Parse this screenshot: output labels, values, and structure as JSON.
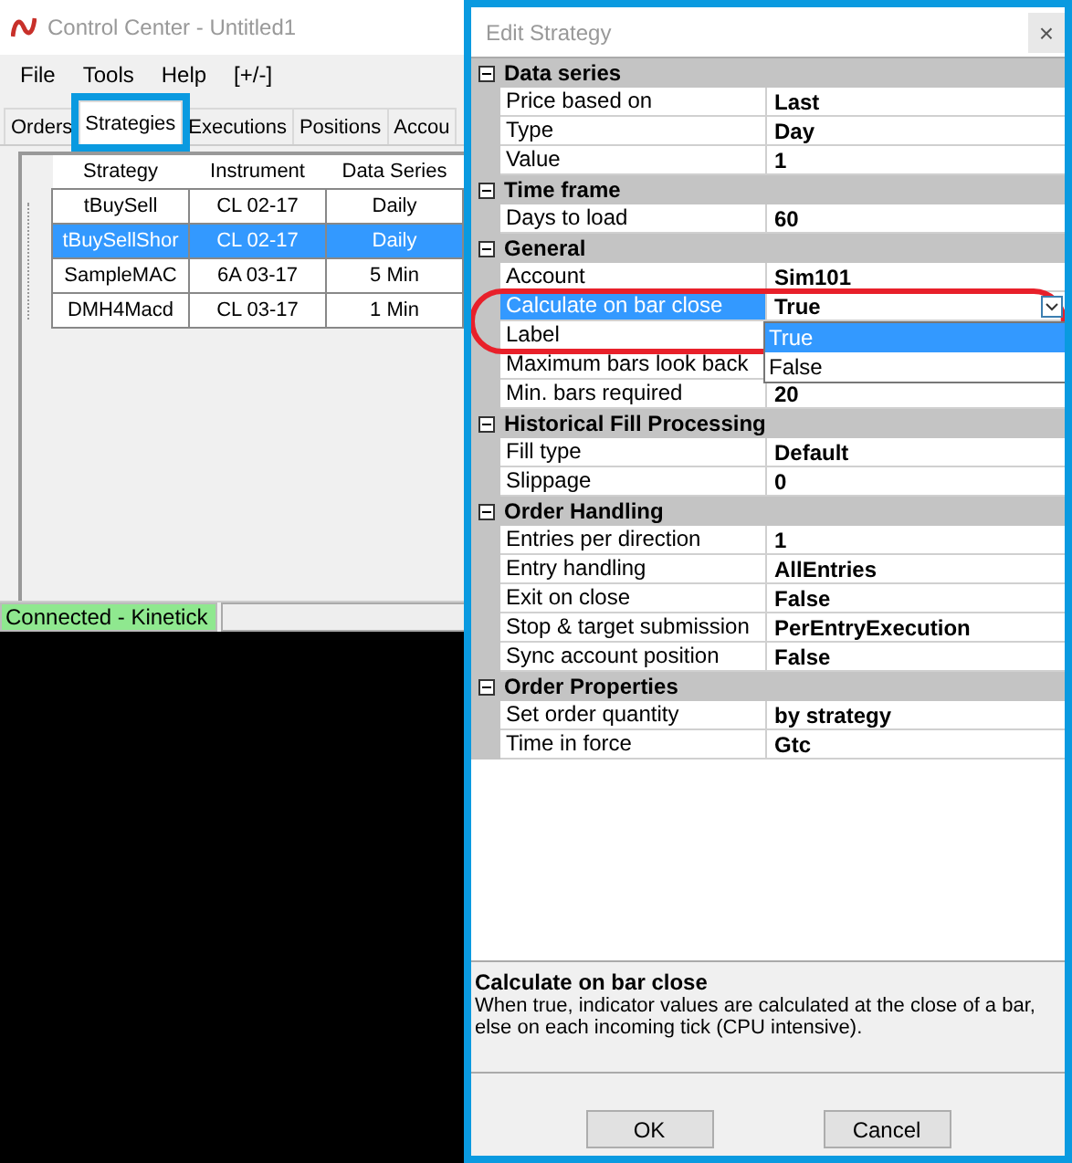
{
  "app_window": {
    "title": "Control Center - Untitled1",
    "menu": [
      "File",
      "Tools",
      "Help",
      "[+/-]"
    ],
    "tabs": [
      {
        "label": "Orders",
        "selected": false,
        "highlighted": false
      },
      {
        "label": "Strategies",
        "selected": true,
        "highlighted": true
      },
      {
        "label": "Executions",
        "selected": false,
        "highlighted": false
      },
      {
        "label": "Positions",
        "selected": false,
        "highlighted": false
      },
      {
        "label": "Accou",
        "selected": false,
        "highlighted": false
      }
    ],
    "strategies_table": {
      "columns": [
        "Strategy",
        "Instrument",
        "Data Series"
      ],
      "rows": [
        {
          "cells": [
            "tBuySell",
            "CL 02-17",
            "Daily"
          ],
          "selected": false
        },
        {
          "cells": [
            "tBuySellShor",
            "CL 02-17",
            "Daily"
          ],
          "selected": true
        },
        {
          "cells": [
            "SampleMAC",
            "6A 03-17",
            "5 Min"
          ],
          "selected": false
        },
        {
          "cells": [
            "DMH4Macd",
            "CL 03-17",
            "1 Min"
          ],
          "selected": false
        }
      ]
    },
    "status_bar": {
      "connection": "Connected - Kinetick",
      "connected": true
    }
  },
  "dialog": {
    "title": "Edit Strategy",
    "close_label": "×",
    "highlighted": true,
    "categories": [
      {
        "name": "Data series",
        "expanded": true,
        "properties": [
          {
            "name": "Price based on",
            "value": "Last",
            "selected": false,
            "kind": "text"
          },
          {
            "name": "Type",
            "value": "Day",
            "selected": false,
            "kind": "text"
          },
          {
            "name": "Value",
            "value": "1",
            "selected": false,
            "kind": "text"
          }
        ]
      },
      {
        "name": "Time frame",
        "expanded": true,
        "properties": [
          {
            "name": "Days to load",
            "value": "60",
            "selected": false,
            "kind": "text"
          }
        ]
      },
      {
        "name": "General",
        "expanded": true,
        "properties": [
          {
            "name": "Account",
            "value": "Sim101",
            "selected": false,
            "kind": "text"
          },
          {
            "name": "Calculate on bar close",
            "value": "True",
            "selected": true,
            "kind": "dropdown",
            "circled": true
          },
          {
            "name": "Label",
            "selected": false,
            "kind": "text"
          },
          {
            "name": "Maximum bars look back",
            "selected": false,
            "kind": "text"
          },
          {
            "name": "Min. bars required",
            "value": "20",
            "selected": false,
            "kind": "text"
          }
        ]
      },
      {
        "name": "Historical Fill Processing",
        "expanded": true,
        "properties": [
          {
            "name": "Fill type",
            "value": "Default",
            "selected": false,
            "kind": "text"
          },
          {
            "name": "Slippage",
            "value": "0",
            "selected": false,
            "kind": "text"
          }
        ]
      },
      {
        "name": "Order Handling",
        "expanded": true,
        "properties": [
          {
            "name": "Entries per direction",
            "value": "1",
            "selected": false,
            "kind": "text"
          },
          {
            "name": "Entry handling",
            "value": "AllEntries",
            "selected": false,
            "kind": "text"
          },
          {
            "name": "Exit on close",
            "value": "False",
            "selected": false,
            "kind": "text"
          },
          {
            "name": "Stop & target submission",
            "value": "PerEntryExecution",
            "selected": false,
            "kind": "text"
          },
          {
            "name": "Sync account position",
            "value": "False",
            "selected": false,
            "kind": "text"
          }
        ]
      },
      {
        "name": "Order Properties",
        "expanded": true,
        "properties": [
          {
            "name": "Set order quantity",
            "value": "by strategy",
            "selected": false,
            "kind": "text"
          },
          {
            "name": "Time in force",
            "value": "Gtc",
            "selected": false,
            "kind": "text"
          }
        ]
      }
    ],
    "dropdown_options": [
      {
        "label": "True",
        "selected": true
      },
      {
        "label": "False",
        "selected": false
      }
    ],
    "description": {
      "title": "Calculate on bar close",
      "text": "When true, indicator values are calculated at the close of a bar, else on each incoming tick (CPU intensive)."
    },
    "buttons": [
      "OK",
      "Cancel"
    ]
  }
}
